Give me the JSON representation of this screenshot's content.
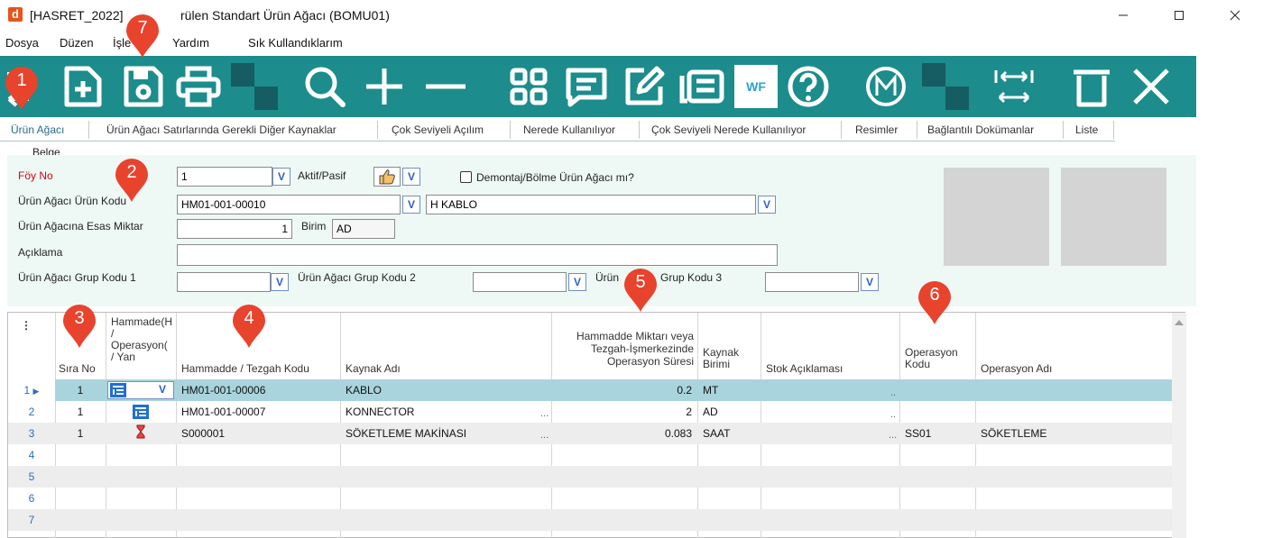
{
  "window": {
    "app_icon_letter": "d",
    "title_left": "[HASRET_2022]",
    "title_right": "rülen Standart Ürün Ağacı (BOMU01)"
  },
  "menu": {
    "items": [
      "Dosya",
      "Düzen",
      "İşle",
      "Yardım",
      "Sık Kullandıklarım"
    ]
  },
  "toolbar": {
    "wf_label": "WF",
    "icons": [
      "previous-icon",
      "new-document-icon",
      "save-icon",
      "print-icon",
      "search-icon",
      "add-icon",
      "remove-icon",
      "grid-view-icon",
      "message-icon",
      "edit-icon",
      "list-icon",
      "workflow-icon",
      "help-icon",
      "m-icon",
      "column-resize-icon",
      "delete-icon",
      "close-icon"
    ],
    "accent_color": "#1c8c8c"
  },
  "tabs": [
    {
      "label": "Ürün Ağacı",
      "active": true
    },
    {
      "label": "Ürün Ağacı Satırlarında Gerekli Diğer Kaynaklar"
    },
    {
      "label": "Çok Seviyeli Açılım"
    },
    {
      "label": "Nerede Kullanılıyor"
    },
    {
      "label": "Çok Seviyeli Nerede Kullanılıyor"
    },
    {
      "label": "Resimler"
    },
    {
      "label": "Bağlantılı Dokümanlar"
    },
    {
      "label": "Liste"
    }
  ],
  "form": {
    "section_label": "Belge",
    "foy_no_label": "Föy No",
    "foy_no_value": "1",
    "aktif_pasif_label": "Aktif/Pasif",
    "demontaj_label": "Demontaj/Bölme Ürün Ağacı mı?",
    "urun_kodu_label": "Ürün Ağacı Ürün Kodu",
    "urun_kodu_value": "HM01-001-00010",
    "urun_adi_value": "H KABLO",
    "esas_miktar_label": "Ürün Ağacına Esas Miktar",
    "esas_miktar_value": "1",
    "birim_label": "Birim",
    "birim_value": "AD",
    "aciklama_label": "Açıklama",
    "aciklama_value": "",
    "grup1_label": "Ürün Ağacı Grup Kodu 1",
    "grup2_label": "Ürün Ağacı Grup Kodu 2",
    "grup3_label_left": "Ürün",
    "grup3_label_right": "Grup Kodu 3",
    "dd_glyph": "V"
  },
  "grid": {
    "columns": {
      "sira_no": "Sıra No",
      "hammadde_type_1": "Hammade(H",
      "hammadde_type_2": "/",
      "hammadde_type_3": "Operasyon(",
      "hammadde_type_4": "/ Yan",
      "kod": "Hammadde / Tezgah Kodu",
      "kaynak_adi": "Kaynak Adı",
      "miktar_1": "Hammadde Miktarı veya",
      "miktar_2": "Tezgah-İşmerkezinde",
      "miktar_3": "Operasyon Süresi",
      "kaynak_birimi_1": "Kaynak",
      "kaynak_birimi_2": "Birimi",
      "stok_aciklama": "Stok Açıklaması",
      "op_kodu_1": "Operasyon",
      "op_kodu_2": "Kodu",
      "op_adi": "Operasyon Adı"
    },
    "rows": [
      {
        "num": "1",
        "sira": "1",
        "type": "hammadde",
        "kod": "HM01-001-00006",
        "kaynak": "KABLO",
        "miktar": "0.2",
        "birim": "MT",
        "op_kodu": "",
        "op_adi": ""
      },
      {
        "num": "2",
        "sira": "1",
        "type": "hammadde",
        "kod": "HM01-001-00007",
        "kaynak": "KONNECTOR",
        "miktar": "2",
        "birim": "AD",
        "op_kodu": "",
        "op_adi": ""
      },
      {
        "num": "3",
        "sira": "1",
        "type": "operasyon",
        "kod": "S000001",
        "kaynak": "SÖKETLEME MAKİNASI",
        "miktar": "0.083",
        "birim": "SAAT",
        "op_kodu": "SS01",
        "op_adi": "SÖKETLEME"
      },
      {
        "num": "4"
      },
      {
        "num": "5"
      },
      {
        "num": "6"
      },
      {
        "num": "7"
      }
    ],
    "ellipsis": "..",
    "ellipsis3": "...",
    "dd_glyph": "V"
  },
  "callouts": [
    "1",
    "2",
    "3",
    "4",
    "5",
    "6",
    "7"
  ],
  "colors": {
    "selected_row": "#a9d4dd",
    "alt_row": "#ededed",
    "callout_red": "#e8432d"
  }
}
